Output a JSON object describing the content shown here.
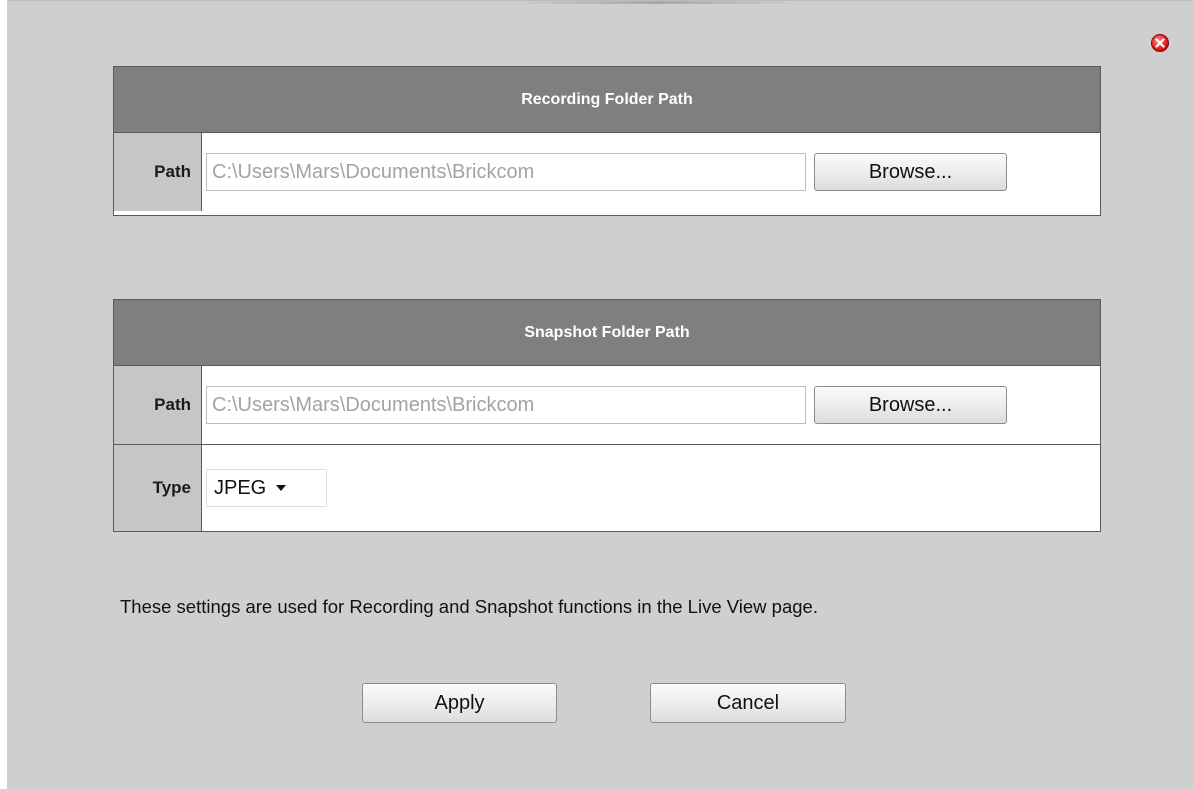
{
  "close_icon": "close-icon",
  "recording": {
    "title": "Recording Folder Path",
    "path_label": "Path",
    "path_value": "C:\\Users\\Mars\\Documents\\Brickcom",
    "browse_label": "Browse..."
  },
  "snapshot": {
    "title": "Snapshot Folder Path",
    "path_label": "Path",
    "path_value": "C:\\Users\\Mars\\Documents\\Brickcom",
    "browse_label": "Browse...",
    "type_label": "Type",
    "type_value": "JPEG"
  },
  "note": "These settings are used for Recording and Snapshot functions in the Live View page.",
  "buttons": {
    "apply": "Apply",
    "cancel": "Cancel"
  },
  "colors": {
    "header_bg": "#7f7f7f",
    "dialog_bg": "#cfcfcf",
    "close_red": "#e02020"
  }
}
